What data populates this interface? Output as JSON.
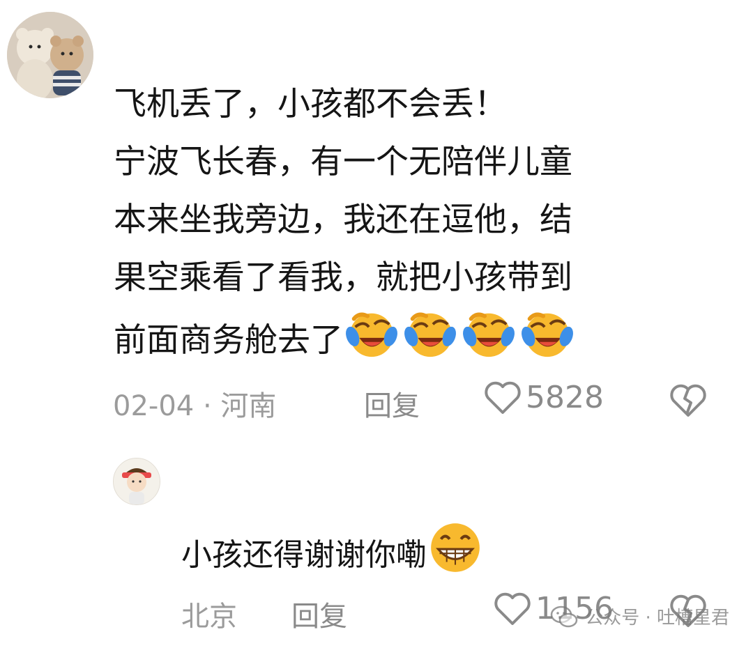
{
  "comments": [
    {
      "avatar_icon": "teddy-bear-avatar-icon",
      "text": "飞机丢了，小孩都不会丢！\n宁波飞长春，有一个无陪伴儿童\n本来坐我旁边，我还在逗他，结\n果空乘看了看我，就把小孩带到\n前面商务舱去了",
      "emojis": [
        "laugh-cry-emoji-icon",
        "laugh-cry-emoji-icon",
        "laugh-cry-emoji-icon",
        "laugh-cry-emoji-icon"
      ],
      "date": "02-04 · 河南",
      "reply_label": "回复",
      "likes": "5828"
    },
    {
      "avatar_icon": "cartoon-kid-avatar-icon",
      "text": "小孩还得谢谢你嘞",
      "emojis": [
        "grin-emoji-icon"
      ],
      "location": "北京",
      "reply_label": "回复",
      "likes": "1156"
    }
  ],
  "watermark": {
    "icon": "wechat-official-account-icon",
    "text": "公众号 · 吐槽星君"
  },
  "colors": {
    "text": "#151515",
    "meta": "#9b9b9b",
    "emoji_yellow": "#f8b92e",
    "emoji_tear": "#3d8fe8"
  }
}
